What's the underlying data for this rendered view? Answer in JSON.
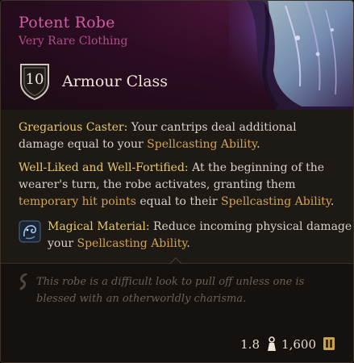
{
  "item": {
    "name": "Potent Robe",
    "rarity": "Very Rare Clothing",
    "armour_class_value": "10",
    "armour_class_label": "Armour Class",
    "rarity_color": "#d75aa9"
  },
  "passives": [
    {
      "name": "Gregarious Caster:",
      "text_1": " Your cantrips deal additional damage equal to your ",
      "highlight_1": "Spellcasting Ability",
      "text_2": "."
    },
    {
      "name": "Well-Liked and Well-Fortified:",
      "text_1": " At the beginning of the wearer's turn, the robe activates, granting them ",
      "highlight_1": "temporary hit points",
      "text_2": " equal to their ",
      "highlight_2": "Spellcasting Ability",
      "text_3": "."
    },
    {
      "name": "Magical Material:",
      "text_1": " Reduce incoming physical damage by",
      "text_2": "your ",
      "highlight_1": "Spellcasting Ability",
      "text_3": ".",
      "icon": "magical-material-icon"
    }
  ],
  "flavour": {
    "text": "This robe is a difficult look to pull off unless one is blessed with an otherworldly charisma.",
    "icon": "quote-icon"
  },
  "footer": {
    "weight": "1.8",
    "weight_icon": "weight-icon",
    "price": "1,600",
    "price_icon": "gold-coin-icon"
  },
  "colors": {
    "name": "#d75aa9",
    "passive_name": "#e8c86a",
    "highlight": "#d6a24e",
    "flavour": "#6b6055"
  }
}
